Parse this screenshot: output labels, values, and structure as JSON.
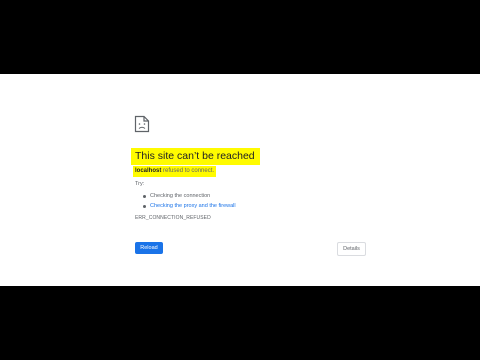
{
  "error": {
    "icon": "sad-page-icon",
    "title": "This site can’t be reached",
    "host": "localhost",
    "message": "refused to connect.",
    "try_label": "Try:",
    "suggestions": [
      "Checking the connection",
      "Checking the proxy and the firewall"
    ],
    "code": "ERR_CONNECTION_REFUSED"
  },
  "buttons": {
    "reload": "Reload",
    "details": "Details"
  },
  "colors": {
    "highlight": "#fffb00",
    "accent": "#1a73e8"
  }
}
